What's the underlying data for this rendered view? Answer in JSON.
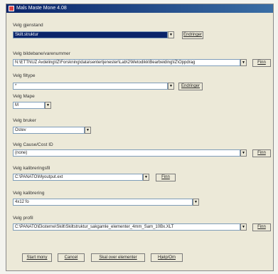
{
  "window_title": "Mals Maste Mone 4.08",
  "groups": [
    {
      "label": "Velg gjenstand",
      "value": "Skilt.struktur"
    },
    {
      "label": "Velg bildebane/varenummer",
      "value": "N:\\ETTNUZ Avdeling\\IZ\\Forskning\\data\\sentertjenester\\Lab\\2\\Metodikk\\Bearbeiding\\IZ\\Oppdrag"
    },
    {
      "label": "Velg filtype",
      "value": "*"
    },
    {
      "label": "Velg Mape",
      "value": "M"
    },
    {
      "label": "Velg bruker",
      "value": "Ostev"
    },
    {
      "label": "Velg Cause/Cost ID",
      "value": "(none)"
    },
    {
      "label": "Velg kalibreringsfil",
      "value": "C:\\PANATO\\Myoutput.ext"
    },
    {
      "label": "Velg kalibrering",
      "value": "4x12 fo"
    },
    {
      "label": "Velg profil",
      "value": "C:\\PANATO\\Eksterne\\Skilt\\Skiltstruktur_sakgamle_elementer_4mm_Sam_10Bx.XLT"
    }
  ],
  "buttons": {
    "endre1": "Endringer",
    "finn1": "Finn",
    "endre2": "Endringer",
    "finn2": "Finn",
    "finn3": "Finn",
    "finn4": "Finn",
    "start": "Start mony",
    "cancel": "Cancel",
    "skal": "Skal over elementer",
    "hjelp": "Hjelp/Om"
  },
  "dropdown_arrow": "▼"
}
